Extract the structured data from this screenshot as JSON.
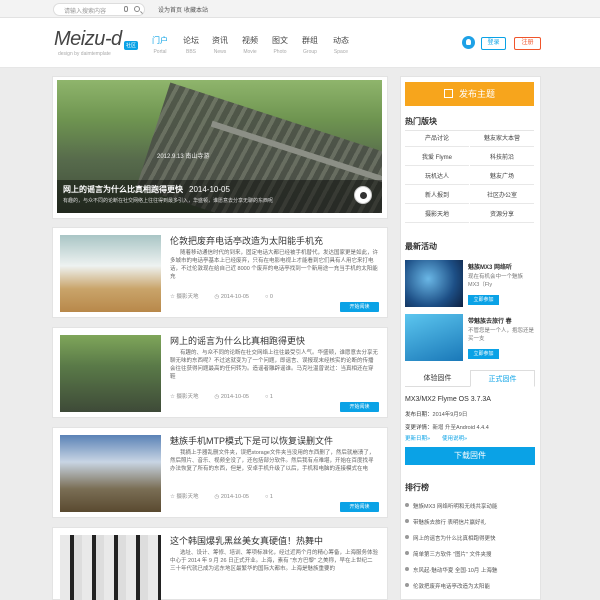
{
  "topbar": {
    "search_placeholder": "请输入搜索内容",
    "link1": "设为首页",
    "link2": "收藏本站"
  },
  "header": {
    "logo": "Meizu-d",
    "logo_badge": "社区",
    "logo_sub": "design by daimtemplate",
    "nav": [
      {
        "label": "门户",
        "sub": "Portal"
      },
      {
        "label": "论坛",
        "sub": "BBS"
      },
      {
        "label": "资讯",
        "sub": "News"
      },
      {
        "label": "视频",
        "sub": "Movie"
      },
      {
        "label": "图文",
        "sub": "Photo"
      },
      {
        "label": "群组",
        "sub": "Group"
      },
      {
        "label": "动态",
        "sub": "Space"
      }
    ],
    "login": "登录",
    "register": "注册"
  },
  "hero": {
    "stamp": "2012.9.13 南山寺游",
    "title": "网上的谣言为什么比真相跑得更快",
    "date": "2014-10-05",
    "excerpt": "有趣的，与众不同的论断在社交网络上往往得到最多引入，华盛顿，谁愿意去分享无聊的东西呢"
  },
  "posts": [
    {
      "title": "伦敦把废弃电话亭改造为太阳能手机充",
      "excerpt": "随着移动通信时代的到来，固定电话大都已经被手机替代，发达国家更是如此，许多城市的电话亭基本上已经废弃，只有在电影电视上才能看到它们具有人用它来打电话，不过伦敦现在给自己近 8000 个废弃的电话亭找到一个新用途一充当手机的太阳能充",
      "author": "摄影天地",
      "date": "2014-10-05",
      "comments": "0",
      "more": "开始阅读"
    },
    {
      "title": "网上的谣言为什么比真相跑得更快",
      "excerpt": "有趣的、与众不同的论断在社交网络上往往最受引人气。华盛顿，谁愿意去分享无聊无味的东西呢？不过这就变为了一个问题，即谣言、误报现末经核实的论断的传播会往往获得问题最高的任何转为。造谣者雕辟谣谁。马克吐温曾说过：当真相还在穿鞋",
      "author": "摄影天地",
      "date": "2014-10-05",
      "comments": "1",
      "more": "开始阅读"
    },
    {
      "title": "魅族手机MTP模式下是可以恢复误删文件",
      "excerpt": "我摘上手器乱删文件夹，误把storage文件夹当没用的东西删了，然后就崩溃了，然后照片、音乐、视频全没了，还包括部分软件。然后我有点难堪，开始在百度找寻办法恢复了所有的东西，但是，安卓手机升级了以后，手机和电脑的连接模式在电",
      "author": "摄影天地",
      "date": "2014-10-05",
      "comments": "1",
      "more": "开始阅读"
    },
    {
      "title": "这个韩国爆乳黑丝美女真硬值！热舞中",
      "excerpt": "选址、设计、筹修、培训、筹项标准化，经过近两个月的精心筹备，上海服务体验中心于 2014 年 9 月 26 日正式开业。上海，素有 \"东方巴黎\" 之美称，早在上世纪二三十年代就已成为远东地区最繁华的国际大都市。上海是魅族重要的",
      "author": "",
      "date": "",
      "comments": "",
      "more": ""
    }
  ],
  "sidebar": {
    "post_button": "发布主题",
    "hot_title": "热门版块",
    "hot": [
      "产品讨论",
      "魅友家大本营",
      "我爱 Flyme",
      "科技前沿",
      "玩机达人",
      "魅友广场",
      "新人报到",
      "社区办公室",
      "摄影天地",
      "资源分享"
    ],
    "events_title": "最新活动",
    "events": [
      {
        "title": "魅族MX3 网络听",
        "desc": "现在有机会中一个魅族MX3（Fly",
        "btn": "立即参加"
      },
      {
        "title": "带魅族去旅行 春",
        "desc": "不管您是一个人，抱怨还是买一支",
        "btn": "立即参加"
      }
    ],
    "tabs": [
      "体验固件",
      "正式固件"
    ],
    "fw_title": "MX3/MX2 Flyme OS 3.7.3A",
    "fw_date_label": "发布日期：",
    "fw_date": "2014年9月9日",
    "fw_notes_label": "变更详情：",
    "fw_notes": "新增 升至Android 4.4.4",
    "fw_link1": "更新日期»",
    "fw_link2": "使用说明»",
    "download": "下载固件",
    "rank_title": "排行榜",
    "rank": [
      "魅族MX3 网络听明和无线共享动能",
      "带魅族去旅行 表明信片赢好礼",
      "网上的谣言为什么比真相跑得更快",
      "简单第三方软件 \"图片\" 文件夹搜",
      "东风起·魅动华夏 全国·10月 上海魅",
      "伦敦把废弃电话亭改造为太阳能"
    ]
  }
}
